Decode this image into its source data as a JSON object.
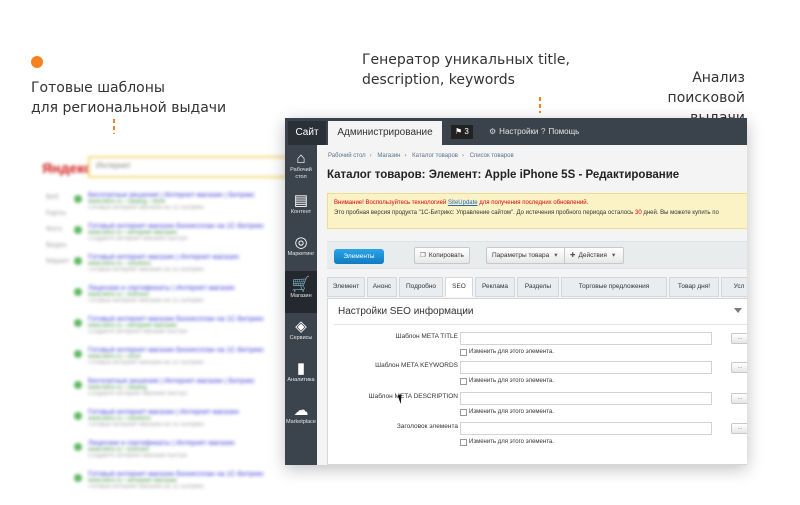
{
  "callouts": {
    "left_line1": "Готовые шаблоны",
    "left_line2": "для региональной выдачи",
    "center_line1": "Генератор уникальных title,",
    "center_line2": "description, keywords",
    "right_line1": "Анализ поисковой",
    "right_line2": "выдачи"
  },
  "accent_color": "#f58220",
  "serp": {
    "logo": "Яндекс",
    "query": "Интернет",
    "menu": [
      "Веб",
      "Карты",
      "Фото",
      "Видео",
      "Маркет"
    ],
    "results": [
      {
        "title": "Бесплатные решения | Интернет-магазин | Битрикс",
        "url": "www.bitrix.ru › catalog › store",
        "desc": "Готовый интернет-магазин на 1С-Битрикс"
      },
      {
        "title": "Готовый интернет-магазин Бизнесплан на 1С-Битрикс",
        "url": "www.bitrix.ru › интернет-магазин",
        "desc": "Создайте интернет-магазин быстро"
      },
      {
        "title": "Готовый интернет-магазин | Интернет-магазин",
        "url": "www.bitrix.ru › solutions",
        "desc": "Готовый интернет-магазин на 1С-Битрикс"
      },
      {
        "title": "Лицензии и сертификаты | Интернет-магазин",
        "url": "www.bitrix.ru › licenses",
        "desc": "Готовый интернет-магазин на 1С-Битрикс"
      },
      {
        "title": "Готовый интернет-магазин Бизнесплан на 1С-Битрикс",
        "url": "www.bitrix.ru › интернет-магазин",
        "desc": "Создайте интернет-магазин быстро"
      },
      {
        "title": "Готовый интернет-магазин Бизнесплан на 1С-Битрикс",
        "url": "www.bitrix.ru › store",
        "desc": "Готовый интернет-магазин на 1С-Битрикс"
      },
      {
        "title": "Бесплатные решения | Интернет-магазин | Битрикс",
        "url": "www.bitrix.ru › catalog",
        "desc": "Создайте интернет-магазин быстро"
      },
      {
        "title": "Готовый интернет-магазин | Интернет-магазин",
        "url": "www.bitrix.ru › solutions",
        "desc": "Готовый интернет-магазин на 1С-Битрикс"
      },
      {
        "title": "Лицензии и сертификаты | Интернет-магазин",
        "url": "www.bitrix.ru › licenses",
        "desc": "Создайте интернет-магазин быстро"
      },
      {
        "title": "Готовый интернет-магазин Бизнесплан на 1С-Битрикс",
        "url": "www.bitrix.ru › интернет-магазин",
        "desc": "Готовый интернет-магазин на 1С-Битрикс"
      }
    ]
  },
  "topbar": {
    "site_tab": "Сайт",
    "admin_tab": "Администрирование",
    "notifications_count": "3",
    "settings": "Настройки",
    "help": "Помощь"
  },
  "sidebar": {
    "items": [
      {
        "icon": "home-icon",
        "label": "Рабочий стол"
      },
      {
        "icon": "document-icon",
        "label": "Контент"
      },
      {
        "icon": "target-icon",
        "label": "Маркетинг"
      },
      {
        "icon": "cart-icon",
        "label": "Магазин"
      },
      {
        "icon": "layers-icon",
        "label": "Сервисы"
      },
      {
        "icon": "bar-chart-icon",
        "label": "Аналитика"
      },
      {
        "icon": "cloud-download-icon",
        "label": "Marketplace"
      }
    ]
  },
  "breadcrumbs": [
    "Рабочий стол",
    "Магазин",
    "Каталог товаров",
    "Список товаров"
  ],
  "page_title": "Каталог товаров: Элемент: Apple iPhone 5S - Редактирование",
  "alert": {
    "line1_prefix": "Внимание! Воспользуйтесь технологией ",
    "line1_link": "SiteUpdate",
    "line1_suffix": " для получения последних обновлений.",
    "line2_prefix": "Это пробная версия продукта \"1С-Битрикс: Управление сайтом\". До истечения пробного периода осталось ",
    "line2_days": "30",
    "line2_suffix": " дней. Вы можете купить по"
  },
  "toolbar": {
    "elements": "Элементы",
    "copy": "Копировать",
    "product_params": "Параметры товара",
    "actions": "Действия"
  },
  "tabs": [
    "Элемент",
    "Анонс",
    "Подробно",
    "SEO",
    "Реклама",
    "Разделы",
    "Торговые предложения",
    "Товар дня!",
    "Усл"
  ],
  "seo": {
    "title": "Настройки SEO информации",
    "fields": [
      {
        "label": "Шаблон META TITLE",
        "checkbox": "Изменить для этого элемента.",
        "button": "..."
      },
      {
        "label": "Шаблон META KEYWORDS",
        "checkbox": "Изменить для этого элемента.",
        "button": "..."
      },
      {
        "label": "Шаблон META DESCRIPTION",
        "checkbox": "Изменить для этого элемента.",
        "button": "..."
      },
      {
        "label": "Заголовок элемента",
        "checkbox": "Изменить для этого элемента.",
        "button": "..."
      }
    ]
  }
}
